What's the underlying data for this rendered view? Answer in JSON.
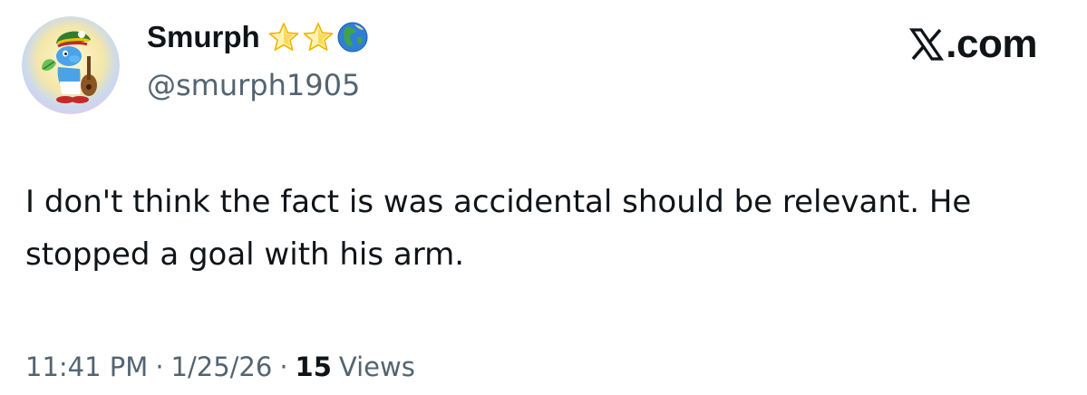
{
  "author": {
    "display_name": "Smurph",
    "handle": "@smurph1905",
    "badges": [
      "star-icon",
      "star-icon",
      "globe-icon"
    ],
    "avatar": "smurf-avatar"
  },
  "brand": {
    "icon": "x-logo-icon",
    "text": ".com"
  },
  "tweet": {
    "text": "I don't think the fact is was accidental should be relevant. He stopped a goal with his arm."
  },
  "meta": {
    "time": "11:41 PM",
    "separator": "·",
    "date": "1/25/26",
    "views_count": "15",
    "views_label": "Views"
  },
  "colors": {
    "text_primary": "#0f1419",
    "text_secondary": "#536471",
    "star": "#f5c518",
    "globe_ocean": "#2f7fd6",
    "globe_land": "#3fa34d"
  }
}
